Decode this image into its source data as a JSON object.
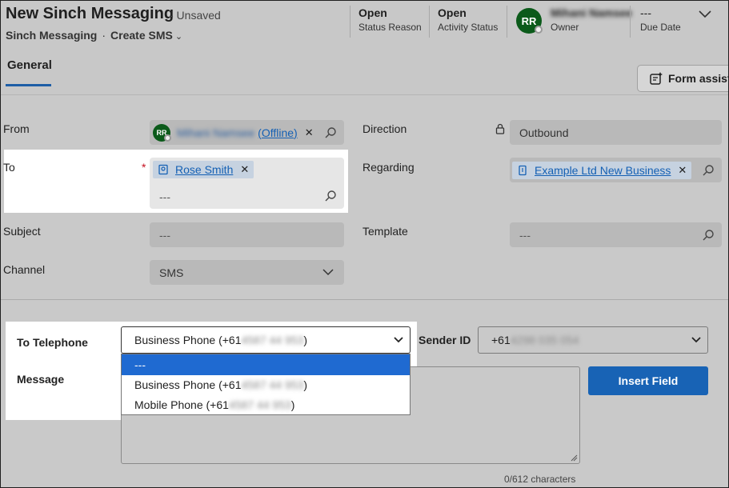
{
  "header": {
    "title": "New Sinch Messaging",
    "unsaved": "- Unsaved",
    "entity": "Sinch Messaging",
    "separator": "·",
    "form_selector": "Create SMS",
    "status_reason_value": "Open",
    "status_reason_label": "Status Reason",
    "activity_status_value": "Open",
    "activity_status_label": "Activity Status",
    "owner_initials": "RR",
    "owner_name": "Mihani Namsee",
    "owner_label": "Owner",
    "due_date_value": "---",
    "due_date_label": "Due Date"
  },
  "tabs": {
    "general": "General"
  },
  "form_assist": "Form assist",
  "form": {
    "from_label": "From",
    "from_initials": "RR",
    "from_name": "Mihani Namsee",
    "from_status": "(Offline)",
    "to_label": "To",
    "required_marker": "*",
    "to_value": "Rose Smith",
    "to_placeholder": "---",
    "direction_label": "Direction",
    "direction_value": "Outbound",
    "regarding_label": "Regarding",
    "regarding_value": "Example Ltd New Business",
    "subject_label": "Subject",
    "subject_placeholder": "---",
    "template_label": "Template",
    "template_placeholder": "---",
    "channel_label": "Channel",
    "channel_value": "SMS"
  },
  "sms": {
    "to_telephone_label": "To Telephone",
    "to_telephone_selected_prefix": "Business Phone (+61",
    "to_telephone_selected_hidden": "4587 44 953",
    "to_telephone_selected_suffix": ")",
    "options": [
      {
        "text": "---"
      },
      {
        "prefix": "Business Phone (+61",
        "hidden": "4587 44 953",
        "suffix": ")"
      },
      {
        "prefix": "Mobile Phone (+61",
        "hidden": "4587 44 953",
        "suffix": ")"
      }
    ],
    "sender_id_label": "Sender ID",
    "sender_id_prefix": "+61",
    "sender_id_hidden": "4298 035 054",
    "message_label": "Message",
    "insert_field_button": "Insert Field",
    "char_count": "0/612 characters"
  }
}
